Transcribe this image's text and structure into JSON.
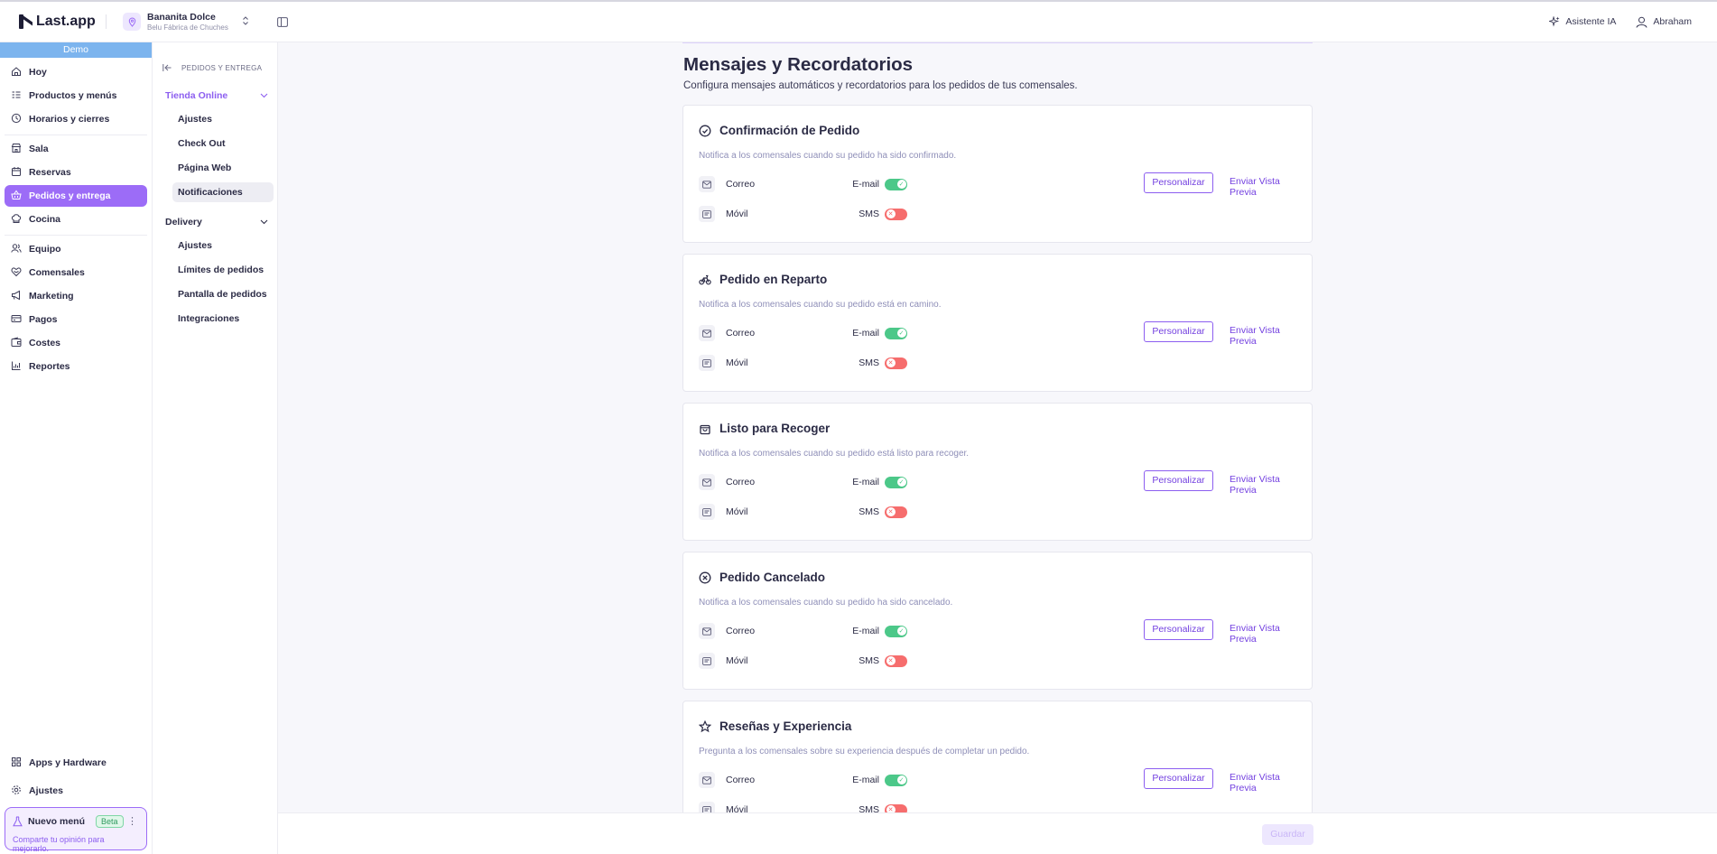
{
  "app": {
    "logo": "Last.app"
  },
  "store": {
    "name": "Bananita Dolce",
    "sub": "Belu Fábrica de Chuches"
  },
  "topbar": {
    "assistant": "Asistente IA",
    "user": "Abraham"
  },
  "sidebar": {
    "demo": "Demo",
    "groups": [
      [
        {
          "label": "Hoy",
          "icon": "home-icon"
        },
        {
          "label": "Productos y menús",
          "icon": "list-icon"
        },
        {
          "label": "Horarios y cierres",
          "icon": "clock-icon"
        }
      ],
      [
        {
          "label": "Sala",
          "icon": "store-icon"
        },
        {
          "label": "Reservas",
          "icon": "calendar-icon"
        },
        {
          "label": "Pedidos y entrega",
          "icon": "basket-icon",
          "active": true
        },
        {
          "label": "Cocina",
          "icon": "chef-hat-icon"
        }
      ],
      [
        {
          "label": "Equipo",
          "icon": "team-icon"
        },
        {
          "label": "Comensales",
          "icon": "heart-icon"
        },
        {
          "label": "Marketing",
          "icon": "megaphone-icon"
        },
        {
          "label": "Pagos",
          "icon": "card-icon"
        },
        {
          "label": "Costes",
          "icon": "wallet-icon"
        },
        {
          "label": "Reportes",
          "icon": "chart-icon"
        }
      ]
    ],
    "bottom": [
      {
        "label": "Apps y Hardware",
        "icon": "grid-icon"
      },
      {
        "label": "Ajustes",
        "icon": "gear-icon"
      }
    ],
    "nuevo": {
      "title": "Nuevo menú",
      "badge": "Beta",
      "sub": "Comparte tu opinión para mejorarlo."
    }
  },
  "subnav": {
    "header": "PEDIDOS Y ENTREGA",
    "tienda": {
      "label": "Tienda Online",
      "items": [
        "Ajustes",
        "Check Out",
        "Página Web",
        "Notificaciones"
      ],
      "active": "Notificaciones"
    },
    "delivery": {
      "label": "Delivery",
      "items": [
        "Ajustes",
        "Límites de pedidos",
        "Pantalla de pedidos",
        "Integraciones"
      ]
    }
  },
  "page": {
    "title": "Mensajes y Recordatorios",
    "description": "Configura mensajes automáticos y recordatorios para los pedidos de tus comensales."
  },
  "channels": {
    "email_name": "Correo",
    "email_label": "E-mail",
    "sms_name": "Móvil",
    "sms_label": "SMS"
  },
  "actions": {
    "personalizar": "Personalizar",
    "preview": "Enviar Vista Previa",
    "save": "Guardar"
  },
  "cards": [
    {
      "title": "Confirmación de Pedido",
      "desc": "Notifica a los comensales cuando su pedido ha sido confirmado.",
      "icon": "check-circle-icon",
      "email_on": true,
      "sms_on": false
    },
    {
      "title": "Pedido en Reparto",
      "desc": "Notifica a los comensales cuando su pedido está en camino.",
      "icon": "bike-icon",
      "email_on": true,
      "sms_on": false
    },
    {
      "title": "Listo para Recoger",
      "desc": "Notifica a los comensales cuando su pedido está listo para recoger.",
      "icon": "bag-icon",
      "email_on": true,
      "sms_on": false
    },
    {
      "title": "Pedido Cancelado",
      "desc": "Notifica a los comensales cuando su pedido ha sido cancelado.",
      "icon": "x-circle-icon",
      "email_on": true,
      "sms_on": false
    },
    {
      "title": "Reseñas y Experiencia",
      "desc": "Pregunta a los comensales sobre su experiencia después de completar un pedido.",
      "icon": "star-icon",
      "email_on": true,
      "sms_on": false
    }
  ]
}
